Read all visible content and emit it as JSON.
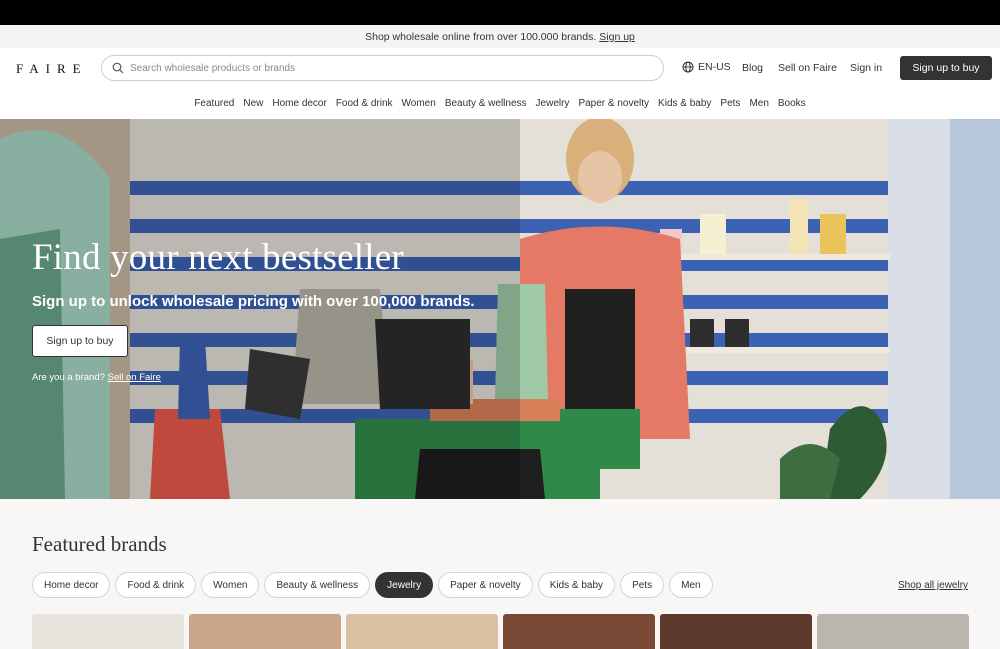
{
  "promo": {
    "text": "Shop wholesale online from over 100.000 brands.",
    "link": "Sign up"
  },
  "header": {
    "logo": "FAIRE",
    "search_placeholder": "Search wholesale products or brands",
    "language": "EN-US",
    "blog": "Blog",
    "sell": "Sell on Faire",
    "sign_in": "Sign in",
    "cta": "Sign up to buy"
  },
  "nav": [
    "Featured",
    "New",
    "Home decor",
    "Food & drink",
    "Women",
    "Beauty & wellness",
    "Jewelry",
    "Paper & novelty",
    "Kids & baby",
    "Pets",
    "Men",
    "Books"
  ],
  "hero": {
    "title": "Find your next bestseller",
    "subtitle": "Sign up to unlock wholesale pricing with over 100,000 brands.",
    "button": "Sign up to buy",
    "brand_question": "Are you a brand?",
    "brand_link": "Sell on Faire"
  },
  "featured": {
    "title": "Featured brands",
    "chips": [
      "Home decor",
      "Food & drink",
      "Women",
      "Beauty & wellness",
      "Jewelry",
      "Paper & novelty",
      "Kids & baby",
      "Pets",
      "Men"
    ],
    "active_chip": "Jewelry",
    "shop_all": "Shop all jewelry"
  },
  "colors": {
    "dark": "#333333",
    "stripe_blue": "#3a5fb0",
    "hero_wall": "#e9e6e0"
  }
}
